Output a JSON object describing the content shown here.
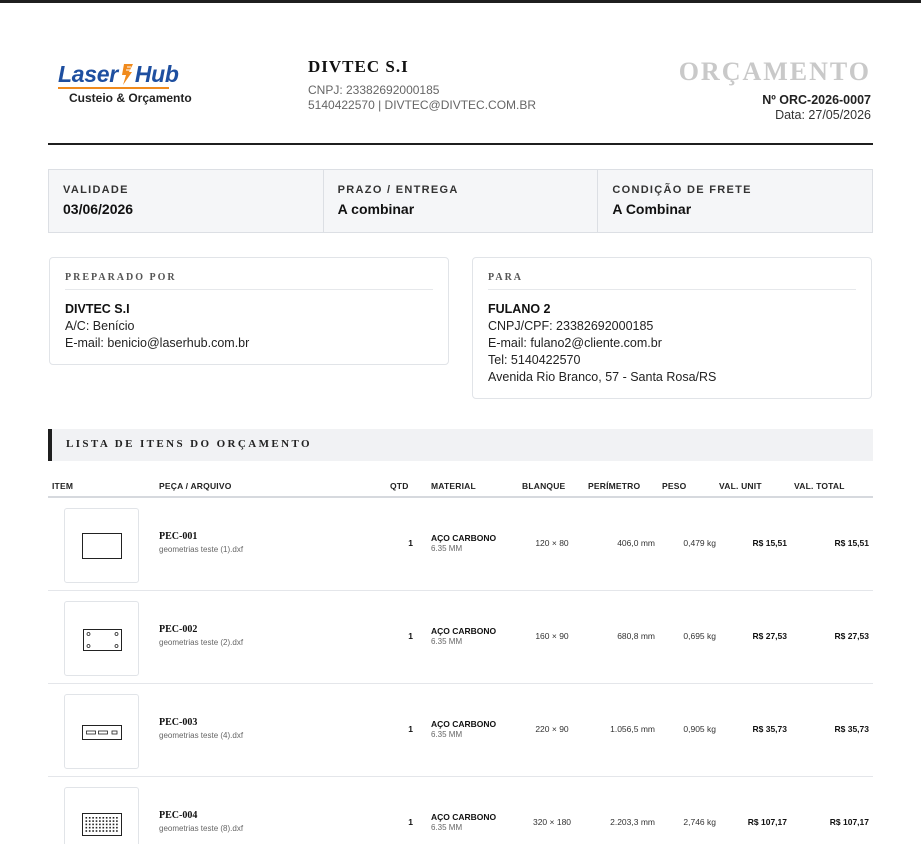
{
  "brand": {
    "logo_word_1": "Laser",
    "logo_word_2": "Hub",
    "logo_subtitle": "Custeio & Orçamento",
    "primary_color": "#1e4fa0",
    "accent_color": "#f08a1c"
  },
  "company": {
    "name": "DIVTEC S.I",
    "cnpj": "CNPJ: 23382692000185",
    "contact": "5140422570 | DIVTEC@DIVTEC.COM.BR"
  },
  "document": {
    "title": "ORÇAMENTO",
    "number": "Nº ORC-2026-0007",
    "date": "Data: 27/05/2026"
  },
  "summary": [
    {
      "label": "VALIDADE",
      "value": "03/06/2026"
    },
    {
      "label": "PRAZO / ENTREGA",
      "value": "A combinar"
    },
    {
      "label": "CONDIÇÃO DE FRETE",
      "value": "A Combinar"
    }
  ],
  "prepared_by": {
    "label": "PREPARADO POR",
    "name": "DIVTEC S.I",
    "lines": [
      "A/C: Benício",
      "E-mail: benicio@laserhub.com.br"
    ]
  },
  "recipient": {
    "label": "PARA",
    "name": "FULANO 2",
    "lines": [
      "CNPJ/CPF: 23382692000185",
      "E-mail: fulano2@cliente.com.br",
      "Tel: 5140422570",
      "Avenida Rio Branco, 57 - Santa Rosa/RS"
    ]
  },
  "items_section": {
    "title": "LISTA DE ITENS DO ORÇAMENTO",
    "columns": {
      "item": "ITEM",
      "part": "PEÇA / ARQUIVO",
      "qty": "QTD",
      "material": "MATERIAL",
      "blank": "BLANQUE",
      "perimeter": "PERÍMETRO",
      "weight": "PESO",
      "unit_value": "VAL. UNIT",
      "total_value": "VAL. TOTAL"
    },
    "rows": [
      {
        "code": "PEC-001",
        "file": "geometrias teste (1).dxf",
        "qty": "1",
        "material": "AÇO CARBONO",
        "thickness": "6.35 MM",
        "blank": "120 × 80",
        "perimeter": "406,0 mm",
        "weight": "0,479 kg",
        "unit_value": "R$ 15,51",
        "total_value": "R$ 15,51",
        "thumb_icon": "plain-plate-icon"
      },
      {
        "code": "PEC-002",
        "file": "geometrias teste (2).dxf",
        "qty": "1",
        "material": "AÇO CARBONO",
        "thickness": "6.35 MM",
        "blank": "160 × 90",
        "perimeter": "680,8 mm",
        "weight": "0,695 kg",
        "unit_value": "R$ 27,53",
        "total_value": "R$ 27,53",
        "thumb_icon": "plate-four-holes-icon"
      },
      {
        "code": "PEC-003",
        "file": "geometrias teste (4).dxf",
        "qty": "1",
        "material": "AÇO CARBONO",
        "thickness": "6.35 MM",
        "blank": "220 × 90",
        "perimeter": "1.056,5 mm",
        "weight": "0,905 kg",
        "unit_value": "R$ 35,73",
        "total_value": "R$ 35,73",
        "thumb_icon": "plate-slots-icon"
      },
      {
        "code": "PEC-004",
        "file": "geometrias teste (8).dxf",
        "qty": "1",
        "material": "AÇO CARBONO",
        "thickness": "6.35 MM",
        "blank": "320 × 180",
        "perimeter": "2.203,3 mm",
        "weight": "2,746 kg",
        "unit_value": "R$ 107,17",
        "total_value": "R$ 107,17",
        "thumb_icon": "plate-hole-grid-icon"
      }
    ]
  }
}
